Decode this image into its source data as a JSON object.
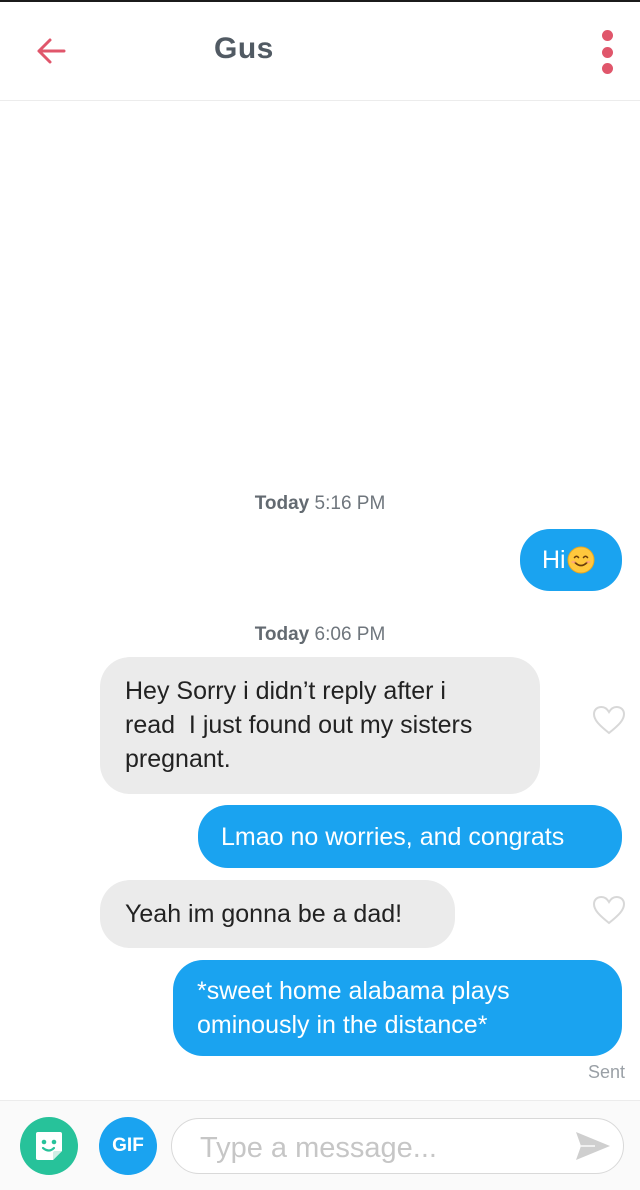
{
  "header": {
    "title": "Gus"
  },
  "thread": [
    {
      "type": "stamp",
      "day": "Today",
      "time": "5:16 PM"
    },
    {
      "type": "out",
      "text": "Hi",
      "emoji": "smiling-face-emoji"
    },
    {
      "type": "stamp",
      "day": "Today",
      "time": "6:06 PM"
    },
    {
      "type": "in",
      "lines": [
        "Hey Sorry i didn’t reply after i",
        "read  I just found out my sisters",
        "pregnant."
      ]
    },
    {
      "type": "out",
      "text": "Lmao no worries, and congrats"
    },
    {
      "type": "in",
      "text": "Yeah im gonna be a dad!"
    },
    {
      "type": "out",
      "lines": [
        "*sweet home alabama plays",
        "ominously in the distance*"
      ]
    }
  ],
  "status": "Sent",
  "composer": {
    "gif_label": "GIF",
    "placeholder": "Type a message..."
  },
  "icons": {
    "back": "back-arrow-icon",
    "menu": "more-vertical-icon",
    "like": "heart-outline-icon",
    "sticker": "sticker-face-icon",
    "send": "send-icon"
  },
  "colors": {
    "accent": "#e0566b",
    "outgoing": "#1aa3f0",
    "incoming": "#ebebeb",
    "sticker": "#27c29a"
  }
}
